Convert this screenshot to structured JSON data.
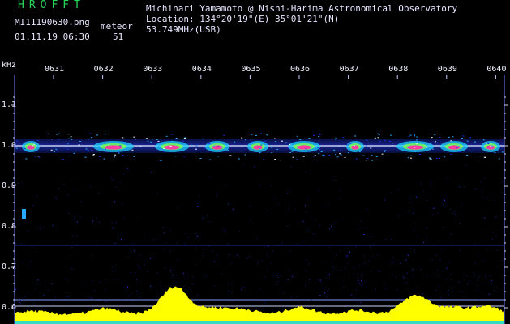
{
  "header": {
    "app_title": "HROFFT",
    "file_name": "MI11190630.png",
    "date_time": "01.11.19 06:30",
    "meteor_label": "meteor",
    "meteor_count": "51",
    "observer": "Michinari Yamamoto @ Nishi-Harima Astronomical Observatory",
    "location": "Location: 134°20'19\"(E) 35°01'21\"(N)",
    "frequency": "53.749MHz(USB)"
  },
  "chart_data": {
    "type": "heatmap",
    "ylabel": "kHz",
    "y_ticks": [
      "1.1",
      "1.0",
      "0.9",
      "0.8",
      "0.7",
      "0.6"
    ],
    "x_ticks": [
      "0631",
      "0632",
      "0633",
      "0634",
      "0635",
      "0636",
      "0637",
      "0638",
      "0639",
      "0640"
    ],
    "ylim": [
      0.6,
      1.15
    ],
    "colors": {
      "trace": "#ffff00",
      "signal_low": "#1e2ee6",
      "signal_mid": "#00d0ff",
      "signal_high": "#ff3ca0",
      "grid": "#4660ff"
    }
  }
}
